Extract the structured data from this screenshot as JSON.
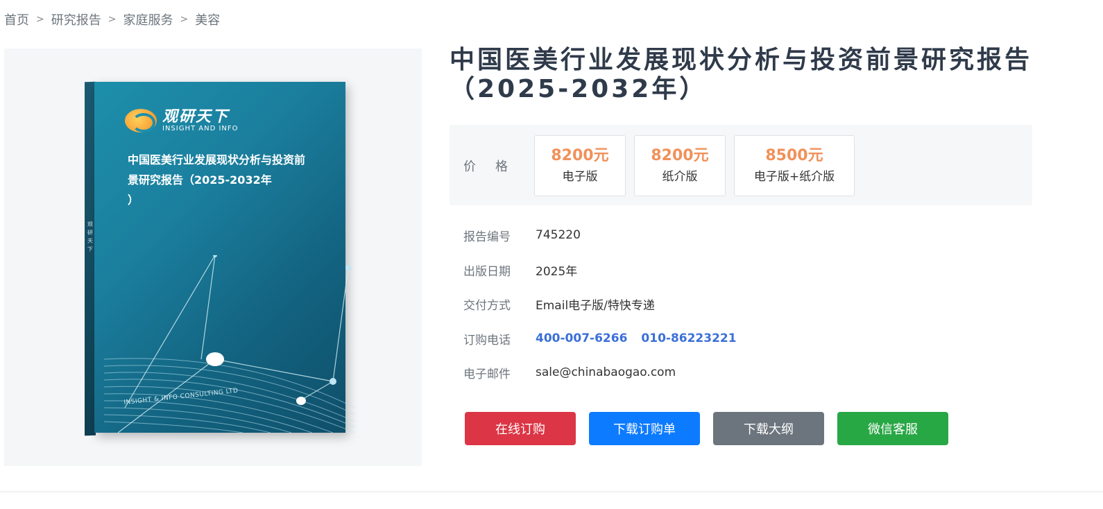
{
  "breadcrumb": {
    "items": [
      "首页",
      "研究报告",
      "家庭服务",
      "美容"
    ],
    "separator": ">"
  },
  "cover": {
    "logo_cn": "观研天下",
    "logo_en": "INSIGHT AND INFO",
    "title_lines": [
      "中国医美行业发展现状分析与投资前",
      "景研究报告（2025-2032年",
      "）"
    ],
    "footer": "INSIGHT & INFO CONSULTING LTD",
    "spine": "观研天下"
  },
  "report": {
    "title": "中国医美行业发展现状分析与投资前景研究报告（2025-2032年）"
  },
  "price": {
    "label": "价格",
    "options": [
      {
        "value": "8200元",
        "type": "电子版"
      },
      {
        "value": "8200元",
        "type": "纸介版"
      },
      {
        "value": "8500元",
        "type": "电子版+纸介版"
      }
    ],
    "value_color": "#f0915a"
  },
  "info": {
    "report_no": {
      "label": "报告编号",
      "value": "745220"
    },
    "publish_date": {
      "label": "出版日期",
      "value": "2025年"
    },
    "delivery": {
      "label": "交付方式",
      "value": "Email电子版/特快专递"
    },
    "phone": {
      "label": "订购电话",
      "values": [
        "400-007-6266",
        "010-86223221"
      ]
    },
    "email": {
      "label": "电子邮件",
      "value": "sale@chinabaogao.com"
    }
  },
  "actions": {
    "order_online": "在线订购",
    "download_order": "下载订购单",
    "download_outline": "下载大纲",
    "wechat_service": "微信客服"
  },
  "colors": {
    "red": "#dc3545",
    "blue": "#0d7bff",
    "gray": "#6c757d",
    "green": "#28a745",
    "phone": "#3b6fd8"
  }
}
